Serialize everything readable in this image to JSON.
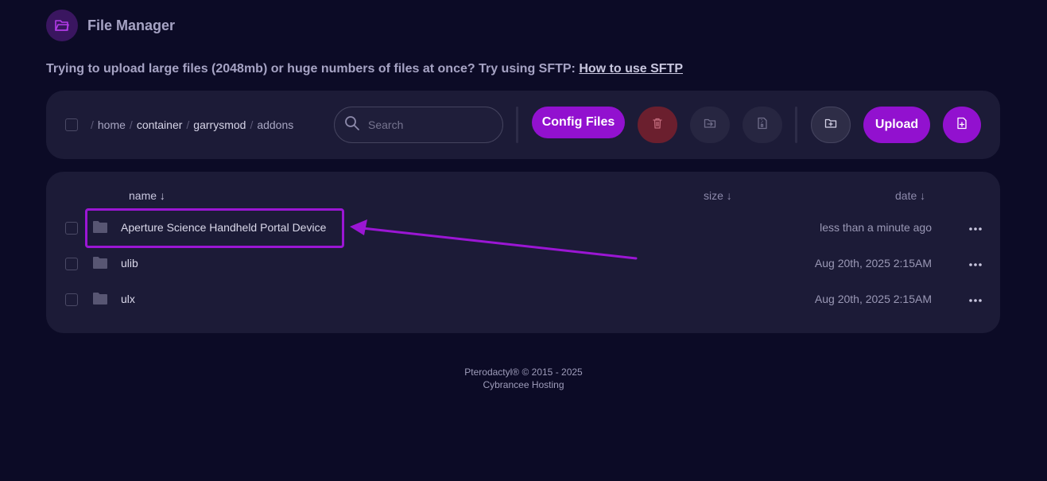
{
  "header": {
    "title": "File Manager",
    "icon": "folder-open-icon"
  },
  "notice": {
    "text": "Trying to upload large files (2048mb) or huge numbers of files at once? Try using SFTP: ",
    "link_label": "How to use SFTP"
  },
  "breadcrumb": {
    "separator": "/",
    "items": [
      "home",
      "container",
      "garrysmod",
      "addons"
    ]
  },
  "search": {
    "placeholder": "Search",
    "value": ""
  },
  "toolbar": {
    "config_files_label": "Config Files",
    "upload_label": "Upload",
    "delete_icon": "trash-icon",
    "move_icon": "folder-move-icon",
    "archive_icon": "file-archive-icon",
    "new_folder_icon": "folder-plus-icon",
    "new_file_icon": "file-plus-icon"
  },
  "columns": {
    "name": "name ↓",
    "size": "size ↓",
    "date": "date ↓"
  },
  "files": [
    {
      "name": "Aperture Science Handheld Portal Device",
      "date": "less than a minute ago"
    },
    {
      "name": "ulib",
      "date": "Aug 20th, 2025 2:15AM"
    },
    {
      "name": "ulx",
      "date": "Aug 20th, 2025 2:15AM"
    }
  ],
  "footer": {
    "line1": "Pterodactyl® © 2015 - 2025",
    "line2": "Cybrancee Hosting"
  },
  "colors": {
    "background": "#0c0b26",
    "card": "#1c1b37",
    "accent": "#9211cf",
    "danger": "#6b1f2e",
    "annotation": "#9b16d4"
  }
}
